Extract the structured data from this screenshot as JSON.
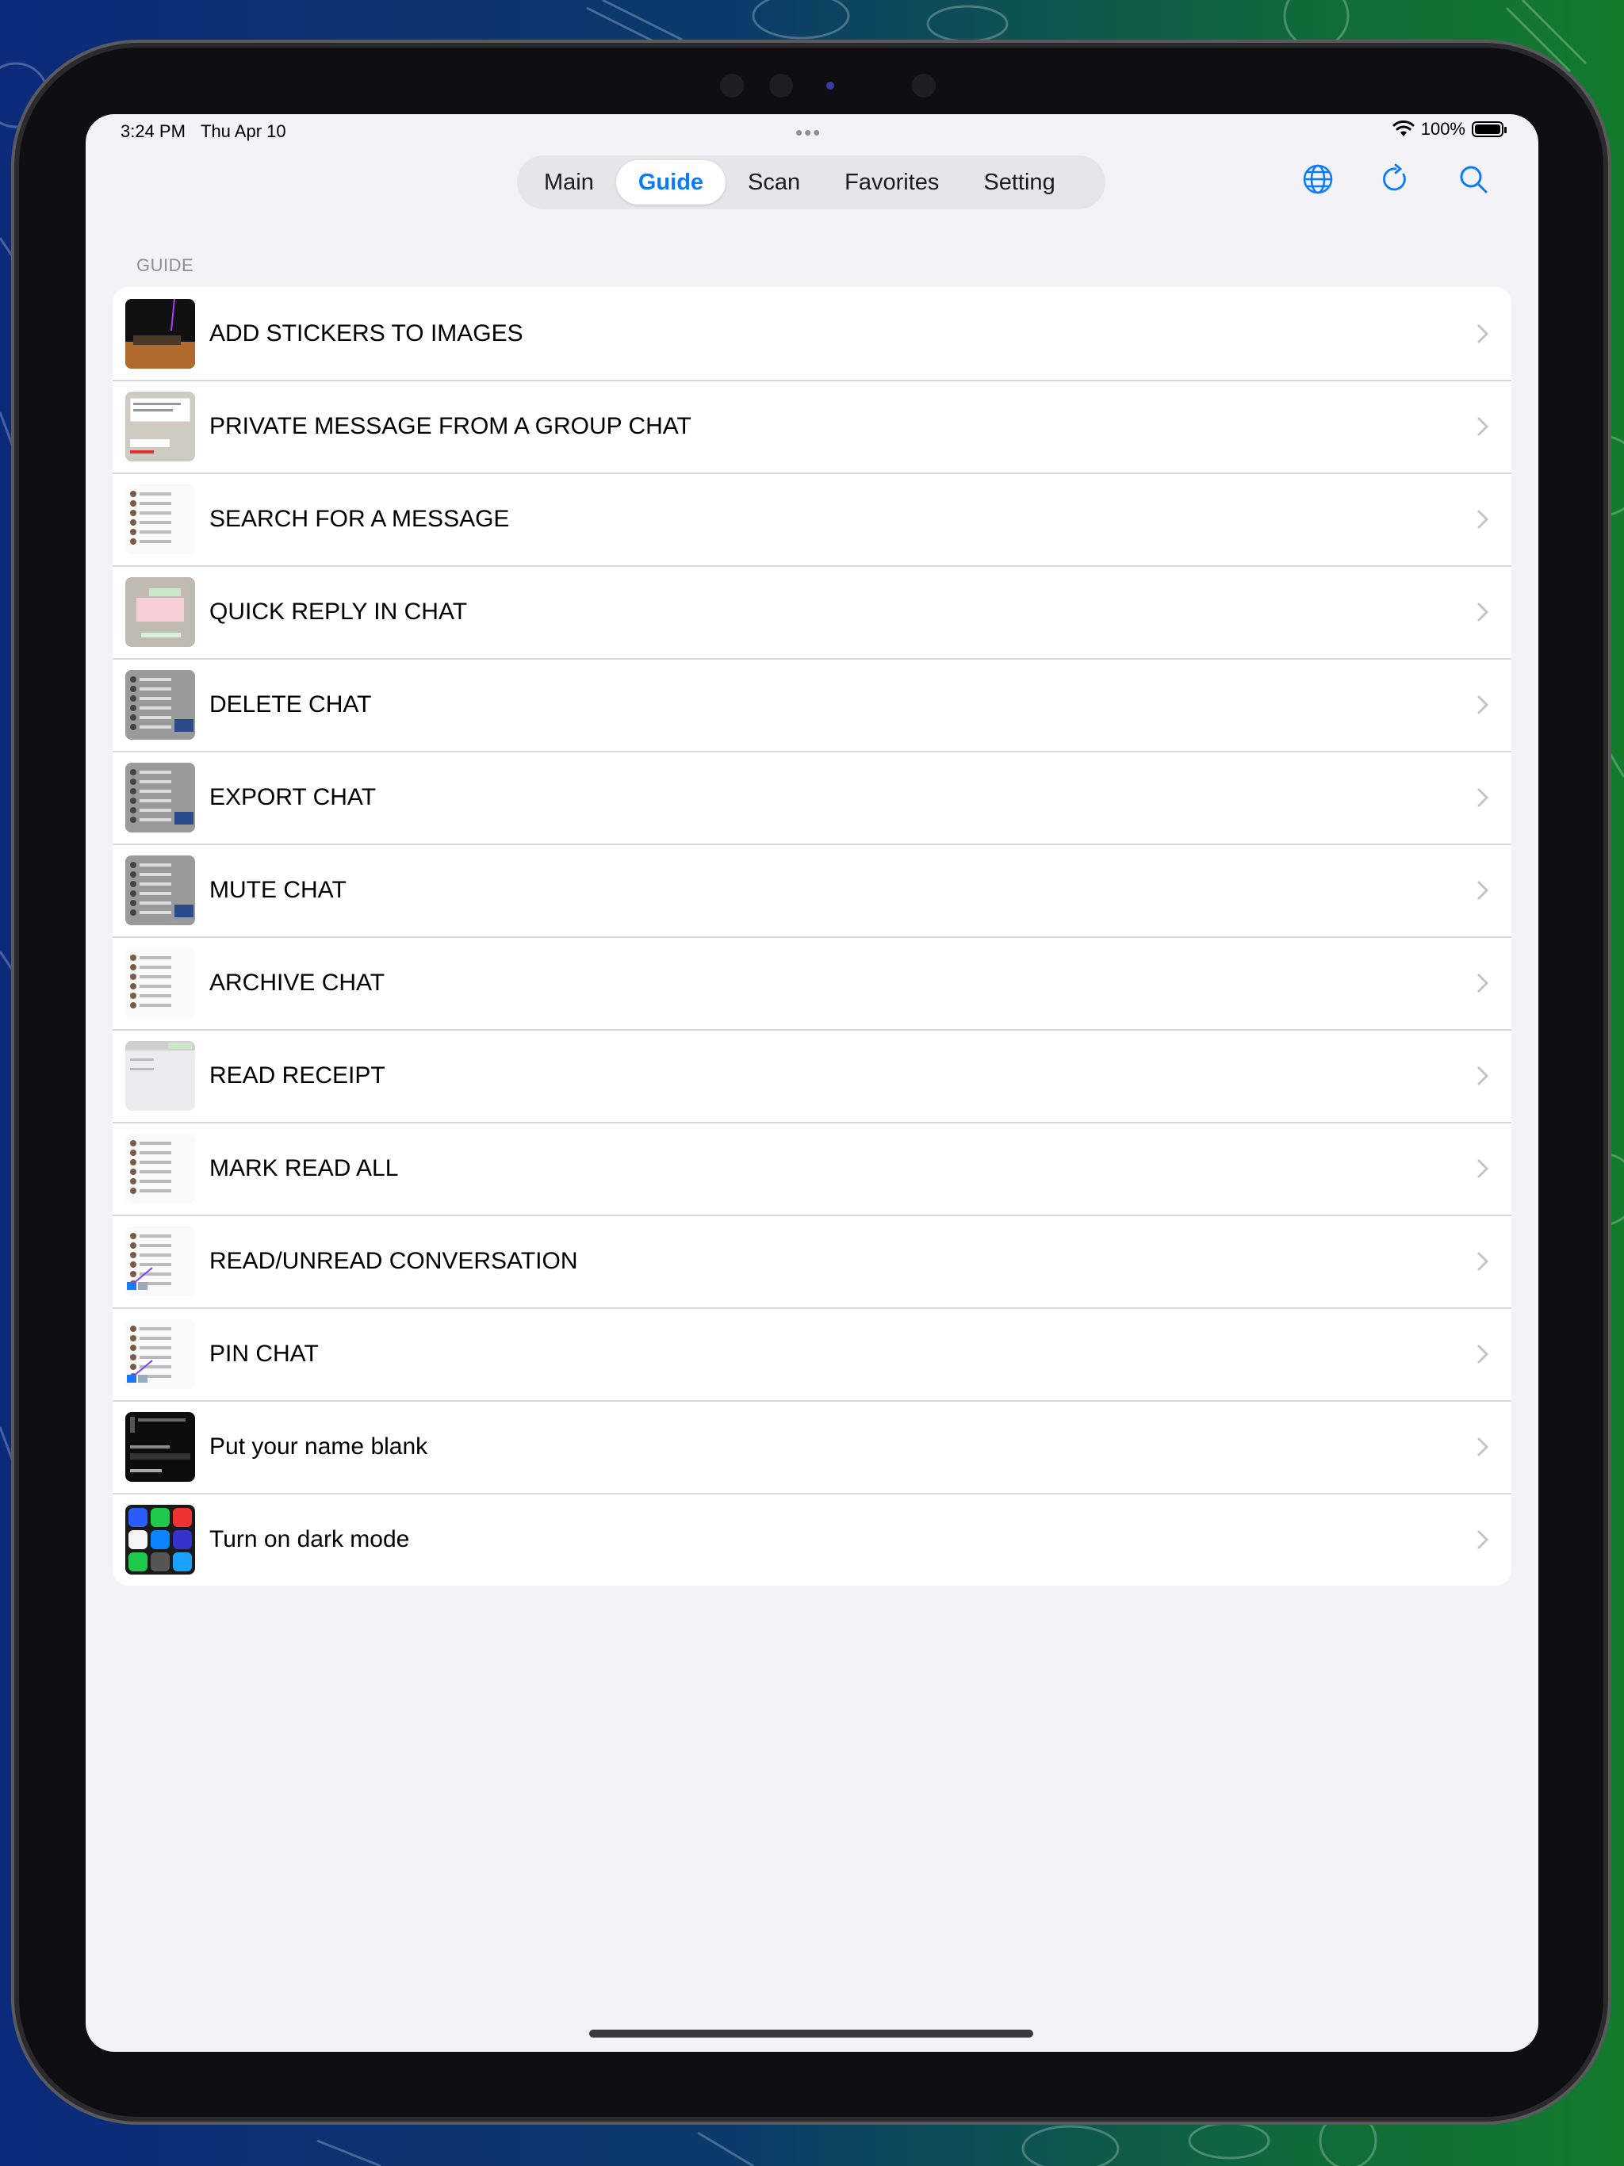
{
  "status_bar": {
    "time": "3:24 PM",
    "date": "Thu Apr 10",
    "battery": "100%",
    "battery_level": 1.0
  },
  "tabs": [
    {
      "label": "Main",
      "active": false
    },
    {
      "label": "Guide",
      "active": true
    },
    {
      "label": "Scan",
      "active": false
    },
    {
      "label": "Favorites",
      "active": false
    },
    {
      "label": "Setting",
      "active": false
    }
  ],
  "toolbar_icons": [
    "globe-icon",
    "refresh-icon",
    "search-icon"
  ],
  "section_header": "GUIDE",
  "colors": {
    "accent": "#0a7aff",
    "background": "#f2f2f7",
    "separator": "#d8d8dc"
  },
  "guide_items": [
    {
      "label": "ADD STICKERS TO IMAGES",
      "thumb": "dark-photo"
    },
    {
      "label": "PRIVATE MESSAGE FROM A GROUP CHAT",
      "thumb": "light-chat"
    },
    {
      "label": "SEARCH FOR A MESSAGE",
      "thumb": "light-list"
    },
    {
      "label": "QUICK REPLY IN CHAT",
      "thumb": "pink-chat"
    },
    {
      "label": "DELETE CHAT",
      "thumb": "gray-list"
    },
    {
      "label": "EXPORT CHAT",
      "thumb": "gray-list"
    },
    {
      "label": "MUTE CHAT",
      "thumb": "gray-list"
    },
    {
      "label": "ARCHIVE CHAT",
      "thumb": "light-list"
    },
    {
      "label": "READ RECEIPT",
      "thumb": "blank"
    },
    {
      "label": "MARK READ ALL",
      "thumb": "light-list"
    },
    {
      "label": "READ/UNREAD CONVERSATION",
      "thumb": "light-list-blue"
    },
    {
      "label": "PIN CHAT",
      "thumb": "light-list-blue"
    },
    {
      "label": "Put your name blank",
      "thumb": "dark-screen"
    },
    {
      "label": "Turn on dark mode",
      "thumb": "app-icons"
    }
  ]
}
